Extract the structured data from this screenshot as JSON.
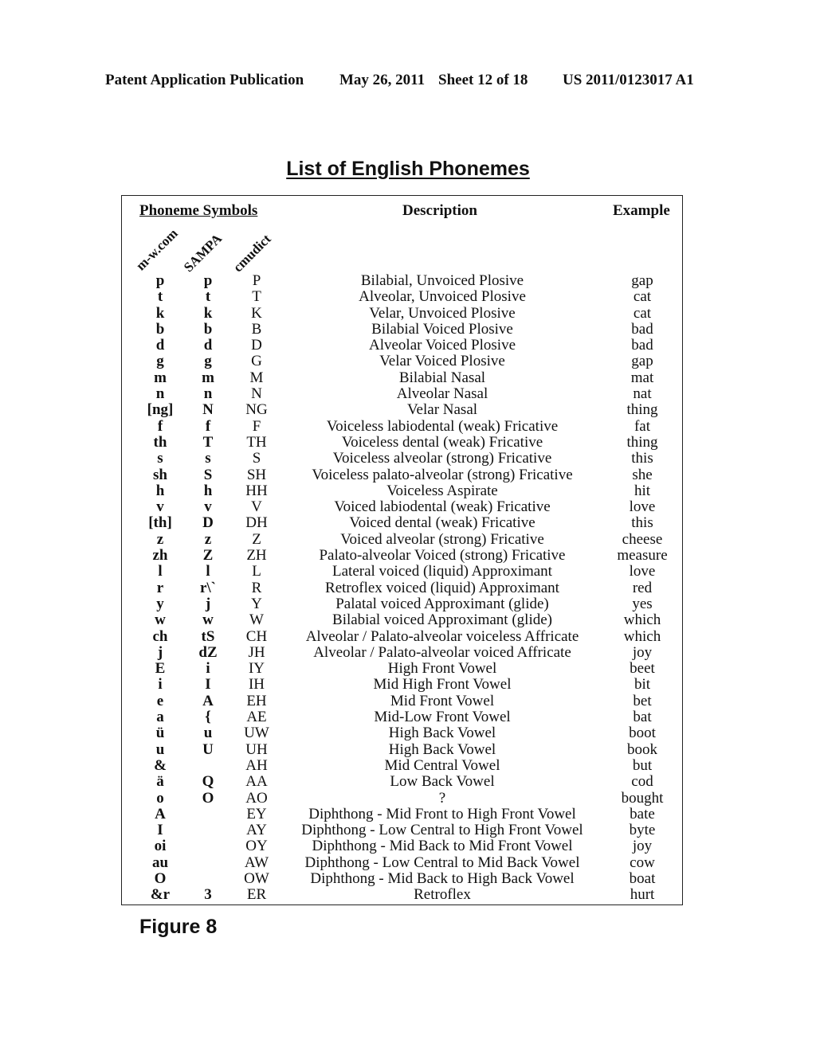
{
  "header": {
    "publication": "Patent Application Publication",
    "date": "May 26, 2011",
    "sheet": "Sheet 12 of 18",
    "number": "US 2011/0123017 A1"
  },
  "title": "List of English Phonemes",
  "table": {
    "headers": {
      "symbols": "Phoneme Symbols",
      "description": "Description",
      "example": "Example"
    },
    "symbol_columns": [
      "m-w.com",
      "SAMPA",
      "cmudict"
    ],
    "rows": [
      {
        "mw": "p",
        "sampa": "p",
        "cmu": "P",
        "desc": "Bilabial, Unvoiced Plosive",
        "example": "gap"
      },
      {
        "mw": "t",
        "sampa": "t",
        "cmu": "T",
        "desc": "Alveolar, Unvoiced Plosive",
        "example": "cat"
      },
      {
        "mw": "k",
        "sampa": "k",
        "cmu": "K",
        "desc": "Velar, Unvoiced Plosive",
        "example": "cat"
      },
      {
        "mw": "b",
        "sampa": "b",
        "cmu": "B",
        "desc": "Bilabial Voiced Plosive",
        "example": "bad"
      },
      {
        "mw": "d",
        "sampa": "d",
        "cmu": "D",
        "desc": "Alveolar Voiced Plosive",
        "example": "bad"
      },
      {
        "mw": "g",
        "sampa": "g",
        "cmu": "G",
        "desc": "Velar Voiced Plosive",
        "example": "gap"
      },
      {
        "mw": "m",
        "sampa": "m",
        "cmu": "M",
        "desc": "Bilabial Nasal",
        "example": "mat"
      },
      {
        "mw": "n",
        "sampa": "n",
        "cmu": "N",
        "desc": "Alveolar Nasal",
        "example": "nat"
      },
      {
        "mw": "[ng]",
        "sampa": "N",
        "cmu": "NG",
        "desc": "Velar Nasal",
        "example": "thing"
      },
      {
        "mw": "f",
        "sampa": "f",
        "cmu": "F",
        "desc": "Voiceless labiodental (weak) Fricative",
        "example": "fat"
      },
      {
        "mw": "th",
        "sampa": "T",
        "cmu": "TH",
        "desc": "Voiceless dental (weak) Fricative",
        "example": "thing"
      },
      {
        "mw": "s",
        "sampa": "s",
        "cmu": "S",
        "desc": "Voiceless alveolar (strong) Fricative",
        "example": "this"
      },
      {
        "mw": "sh",
        "sampa": "S",
        "cmu": "SH",
        "desc": "Voiceless palato-alveolar (strong) Fricative",
        "example": "she"
      },
      {
        "mw": "h",
        "sampa": "h",
        "cmu": "HH",
        "desc": "Voiceless Aspirate",
        "example": "hit"
      },
      {
        "mw": "v",
        "sampa": "v",
        "cmu": "V",
        "desc": "Voiced labiodental (weak) Fricative",
        "example": "love"
      },
      {
        "mw": "[th]",
        "sampa": "D",
        "cmu": "DH",
        "desc": "Voiced dental (weak) Fricative",
        "example": "this"
      },
      {
        "mw": "z",
        "sampa": "z",
        "cmu": "Z",
        "desc": "Voiced alveolar (strong) Fricative",
        "example": "cheese"
      },
      {
        "mw": "zh",
        "sampa": "Z",
        "cmu": "ZH",
        "desc": "Palato-alveolar Voiced (strong) Fricative",
        "example": "measure"
      },
      {
        "mw": "l",
        "sampa": "l",
        "cmu": "L",
        "desc": "Lateral voiced (liquid) Approximant",
        "example": "love"
      },
      {
        "mw": "r",
        "sampa": "r\\`",
        "cmu": "R",
        "desc": "Retroflex voiced (liquid) Approximant",
        "example": "red"
      },
      {
        "mw": "y",
        "sampa": "j",
        "cmu": "Y",
        "desc": "Palatal voiced Approximant (glide)",
        "example": "yes"
      },
      {
        "mw": "w",
        "sampa": "w",
        "cmu": "W",
        "desc": "Bilabial voiced Approximant (glide)",
        "example": "which"
      },
      {
        "mw": "ch",
        "sampa": "tS",
        "cmu": "CH",
        "desc": "Alveolar / Palato-alveolar voiceless Affricate",
        "example": "which"
      },
      {
        "mw": "j",
        "sampa": "dZ",
        "cmu": "JH",
        "desc": "Alveolar / Palato-alveolar voiced Affricate",
        "example": "joy"
      },
      {
        "mw": "E",
        "sampa": "i",
        "cmu": "IY",
        "desc": "High Front Vowel",
        "example": "beet"
      },
      {
        "mw": "i",
        "sampa": "I",
        "cmu": "IH",
        "desc": "Mid High Front Vowel",
        "example": "bit"
      },
      {
        "mw": "e",
        "sampa": "A",
        "cmu": "EH",
        "desc": "Mid Front Vowel",
        "example": "bet"
      },
      {
        "mw": "a",
        "sampa": "{",
        "cmu": "AE",
        "desc": "Mid-Low Front Vowel",
        "example": "bat"
      },
      {
        "mw": "ü",
        "sampa": "u",
        "cmu": "UW",
        "desc": "High Back Vowel",
        "example": "boot"
      },
      {
        "mw": "u",
        "sampa": "U",
        "cmu": "UH",
        "desc": "High Back Vowel",
        "example": "book"
      },
      {
        "mw": "&",
        "sampa": "",
        "cmu": "AH",
        "desc": "Mid Central Vowel",
        "example": "but"
      },
      {
        "mw": "ä",
        "sampa": "Q",
        "cmu": "AA",
        "desc": "Low Back Vowel",
        "example": "cod"
      },
      {
        "mw": "o",
        "sampa": "O",
        "cmu": "AO",
        "desc": "?",
        "example": "bought"
      },
      {
        "mw": "A",
        "sampa": "",
        "cmu": "EY",
        "desc": "Diphthong - Mid Front to High Front Vowel",
        "example": "bate"
      },
      {
        "mw": "I",
        "sampa": "",
        "cmu": "AY",
        "desc": "Diphthong - Low Central to High Front Vowel",
        "example": "byte"
      },
      {
        "mw": "oi",
        "sampa": "",
        "cmu": "OY",
        "desc": "Diphthong - Mid Back to Mid Front Vowel",
        "example": "joy"
      },
      {
        "mw": "au",
        "sampa": "",
        "cmu": "AW",
        "desc": "Diphthong - Low Central to Mid Back Vowel",
        "example": "cow"
      },
      {
        "mw": "O",
        "sampa": "",
        "cmu": "OW",
        "desc": "Diphthong - Mid Back to High Back Vowel",
        "example": "boat"
      },
      {
        "mw": "&r",
        "sampa": "3",
        "cmu": "ER",
        "desc": "Retroflex",
        "example": "hurt"
      }
    ]
  },
  "figure_label": "Figure 8"
}
